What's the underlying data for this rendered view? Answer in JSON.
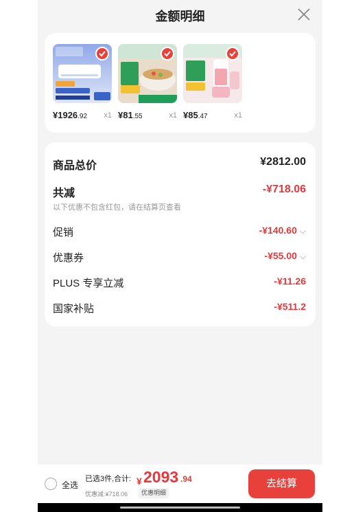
{
  "header": {
    "title": "金额明细"
  },
  "products": [
    {
      "price_int": "¥1926",
      "price_dec": ".92",
      "qty": "x1"
    },
    {
      "price_int": "¥81",
      "price_dec": ".55",
      "qty": "x1"
    },
    {
      "price_int": "¥85",
      "price_dec": ".47",
      "qty": "x1"
    }
  ],
  "summary": {
    "goods_total_label": "商品总价",
    "goods_total_value": "¥2812.00",
    "total_discount_label": "共减",
    "total_discount_value": "-¥718.06",
    "note": "以下优惠不包含红包，请在结算页查看",
    "items": [
      {
        "label": "促销",
        "value": "-¥140.60"
      },
      {
        "label": "优惠券",
        "value": "-¥55.00"
      },
      {
        "label": "PLUS 专享立减",
        "value": "-¥11.26"
      },
      {
        "label": "国家补贴",
        "value": "-¥511.2"
      }
    ]
  },
  "bottom": {
    "select_all": "全选",
    "summary_text": "已选3件,合计:",
    "total_symbol": "¥",
    "total_int": "2093",
    "total_dec": ".94",
    "discount_text": "优惠减:¥718.06",
    "detail_button": "优惠明细",
    "checkout_button": "去结算"
  },
  "colors": {
    "accent": "#e8413b",
    "price_red": "#e4393c",
    "background": "#f4f4f4"
  }
}
